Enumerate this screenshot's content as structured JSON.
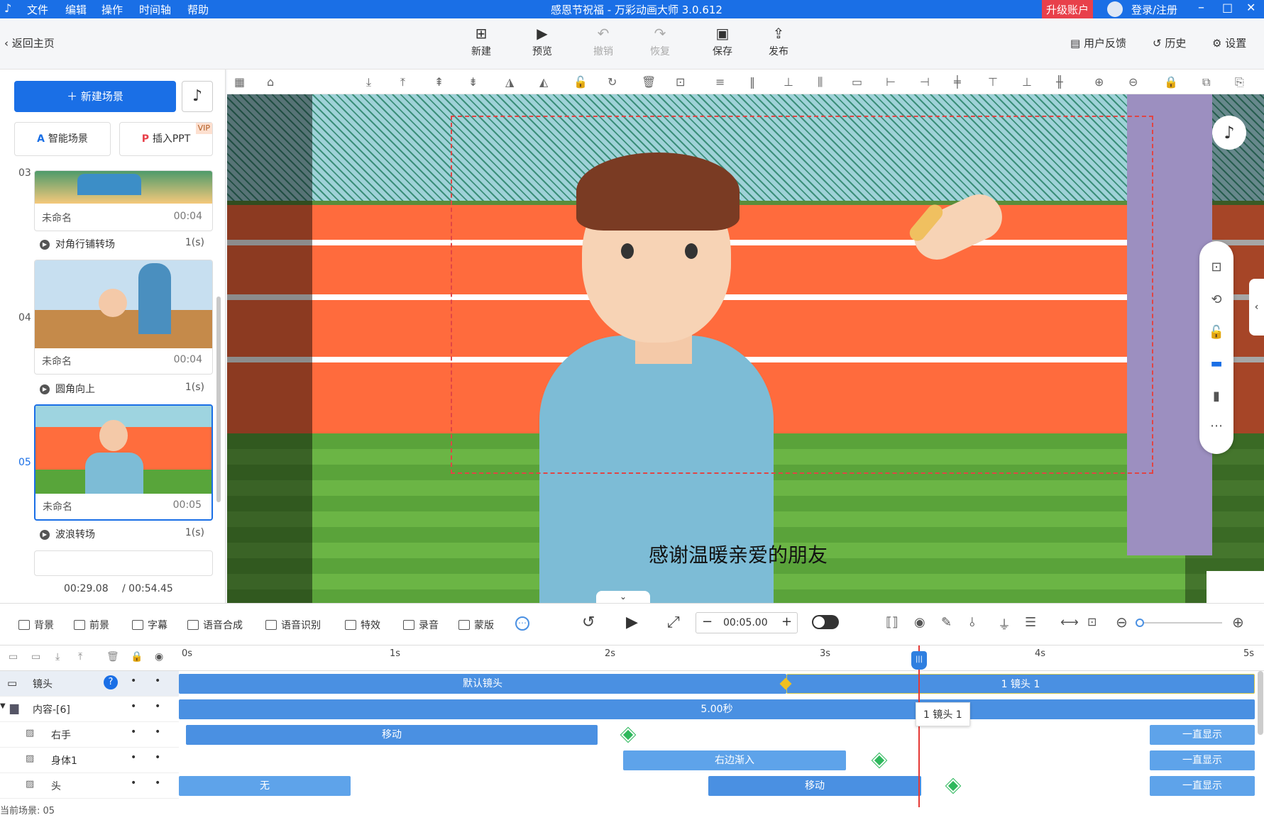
{
  "app": {
    "title": "感恩节祝福 - 万彩动画大师 3.0.612",
    "menu": [
      "文件",
      "编辑",
      "操作",
      "时间轴",
      "帮助"
    ],
    "upgrade_label": "升级账户",
    "login_label": "登录/注册"
  },
  "toolbar": {
    "back_label": "返回主页",
    "buttons": [
      "新建",
      "预览",
      "撤销",
      "恢复",
      "保存",
      "发布"
    ],
    "feedback_label": "用户反馈",
    "history_label": "历史",
    "settings_label": "设置"
  },
  "left_panel": {
    "new_scene_label": "新建场景",
    "smart_scene_label": "智能场景",
    "insert_ppt_label": "插入PPT",
    "vip_label": "VIP",
    "scenes": [
      {
        "num": "03",
        "name": "未命名",
        "duration": "00:04"
      },
      {
        "num": "04",
        "name": "未命名",
        "duration": "00:04"
      },
      {
        "num": "05",
        "name": "未命名",
        "duration": "00:05"
      }
    ],
    "transitions": [
      {
        "name": "对角行铺转场",
        "dur": "1(s)"
      },
      {
        "name": "圆角向上",
        "dur": "1(s)"
      },
      {
        "name": "波浪转场",
        "dur": "1(s)"
      }
    ],
    "current_time": "00:29.08",
    "total_time": "/ 00:54.45"
  },
  "canvas": {
    "subtitle": "感谢温暖亲爱的朋友"
  },
  "bottom_bar": {
    "items": [
      "背景",
      "前景",
      "字幕",
      "语音合成",
      "语音识别",
      "特效",
      "录音",
      "蒙版"
    ],
    "time_value": "00:05.00"
  },
  "timeline": {
    "ruler": [
      "0s",
      "1s",
      "2s",
      "3s",
      "4s",
      "5s"
    ],
    "tracks": [
      {
        "name": "镜头"
      },
      {
        "name": "内容-[6]"
      },
      {
        "name": "右手"
      },
      {
        "name": "身体1"
      },
      {
        "name": "头"
      }
    ],
    "camera_default": "默认镜头",
    "camera_1": "1 镜头 1",
    "content_duration": "5.00秒",
    "tooltip": "1 镜头 1",
    "righthand_move": "移动",
    "body_enter": "右边渐入",
    "head_none": "无",
    "head_move": "移动",
    "always_show": "一直显示",
    "current_scene": "当前场景: 05"
  }
}
